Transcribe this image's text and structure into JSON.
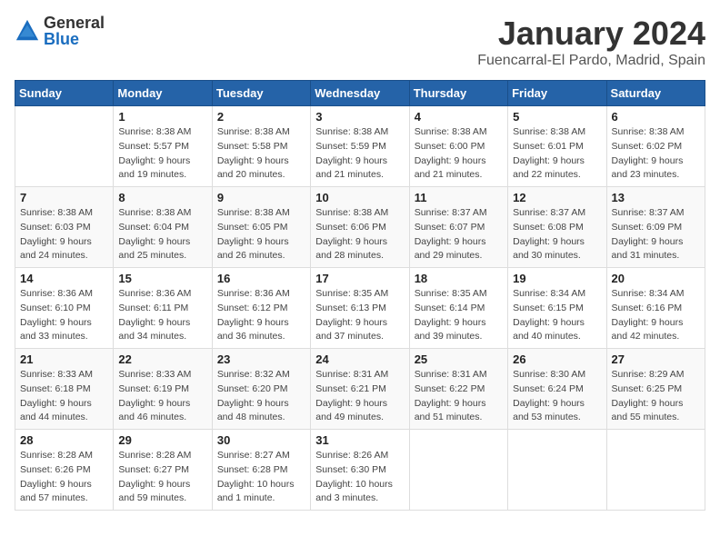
{
  "logo": {
    "general": "General",
    "blue": "Blue"
  },
  "title": "January 2024",
  "subtitle": "Fuencarral-El Pardo, Madrid, Spain",
  "days_header": [
    "Sunday",
    "Monday",
    "Tuesday",
    "Wednesday",
    "Thursday",
    "Friday",
    "Saturday"
  ],
  "weeks": [
    [
      {
        "day": "",
        "info": ""
      },
      {
        "day": "1",
        "info": "Sunrise: 8:38 AM\nSunset: 5:57 PM\nDaylight: 9 hours\nand 19 minutes."
      },
      {
        "day": "2",
        "info": "Sunrise: 8:38 AM\nSunset: 5:58 PM\nDaylight: 9 hours\nand 20 minutes."
      },
      {
        "day": "3",
        "info": "Sunrise: 8:38 AM\nSunset: 5:59 PM\nDaylight: 9 hours\nand 21 minutes."
      },
      {
        "day": "4",
        "info": "Sunrise: 8:38 AM\nSunset: 6:00 PM\nDaylight: 9 hours\nand 21 minutes."
      },
      {
        "day": "5",
        "info": "Sunrise: 8:38 AM\nSunset: 6:01 PM\nDaylight: 9 hours\nand 22 minutes."
      },
      {
        "day": "6",
        "info": "Sunrise: 8:38 AM\nSunset: 6:02 PM\nDaylight: 9 hours\nand 23 minutes."
      }
    ],
    [
      {
        "day": "7",
        "info": "Sunrise: 8:38 AM\nSunset: 6:03 PM\nDaylight: 9 hours\nand 24 minutes."
      },
      {
        "day": "8",
        "info": "Sunrise: 8:38 AM\nSunset: 6:04 PM\nDaylight: 9 hours\nand 25 minutes."
      },
      {
        "day": "9",
        "info": "Sunrise: 8:38 AM\nSunset: 6:05 PM\nDaylight: 9 hours\nand 26 minutes."
      },
      {
        "day": "10",
        "info": "Sunrise: 8:38 AM\nSunset: 6:06 PM\nDaylight: 9 hours\nand 28 minutes."
      },
      {
        "day": "11",
        "info": "Sunrise: 8:37 AM\nSunset: 6:07 PM\nDaylight: 9 hours\nand 29 minutes."
      },
      {
        "day": "12",
        "info": "Sunrise: 8:37 AM\nSunset: 6:08 PM\nDaylight: 9 hours\nand 30 minutes."
      },
      {
        "day": "13",
        "info": "Sunrise: 8:37 AM\nSunset: 6:09 PM\nDaylight: 9 hours\nand 31 minutes."
      }
    ],
    [
      {
        "day": "14",
        "info": "Sunrise: 8:36 AM\nSunset: 6:10 PM\nDaylight: 9 hours\nand 33 minutes."
      },
      {
        "day": "15",
        "info": "Sunrise: 8:36 AM\nSunset: 6:11 PM\nDaylight: 9 hours\nand 34 minutes."
      },
      {
        "day": "16",
        "info": "Sunrise: 8:36 AM\nSunset: 6:12 PM\nDaylight: 9 hours\nand 36 minutes."
      },
      {
        "day": "17",
        "info": "Sunrise: 8:35 AM\nSunset: 6:13 PM\nDaylight: 9 hours\nand 37 minutes."
      },
      {
        "day": "18",
        "info": "Sunrise: 8:35 AM\nSunset: 6:14 PM\nDaylight: 9 hours\nand 39 minutes."
      },
      {
        "day": "19",
        "info": "Sunrise: 8:34 AM\nSunset: 6:15 PM\nDaylight: 9 hours\nand 40 minutes."
      },
      {
        "day": "20",
        "info": "Sunrise: 8:34 AM\nSunset: 6:16 PM\nDaylight: 9 hours\nand 42 minutes."
      }
    ],
    [
      {
        "day": "21",
        "info": "Sunrise: 8:33 AM\nSunset: 6:18 PM\nDaylight: 9 hours\nand 44 minutes."
      },
      {
        "day": "22",
        "info": "Sunrise: 8:33 AM\nSunset: 6:19 PM\nDaylight: 9 hours\nand 46 minutes."
      },
      {
        "day": "23",
        "info": "Sunrise: 8:32 AM\nSunset: 6:20 PM\nDaylight: 9 hours\nand 48 minutes."
      },
      {
        "day": "24",
        "info": "Sunrise: 8:31 AM\nSunset: 6:21 PM\nDaylight: 9 hours\nand 49 minutes."
      },
      {
        "day": "25",
        "info": "Sunrise: 8:31 AM\nSunset: 6:22 PM\nDaylight: 9 hours\nand 51 minutes."
      },
      {
        "day": "26",
        "info": "Sunrise: 8:30 AM\nSunset: 6:24 PM\nDaylight: 9 hours\nand 53 minutes."
      },
      {
        "day": "27",
        "info": "Sunrise: 8:29 AM\nSunset: 6:25 PM\nDaylight: 9 hours\nand 55 minutes."
      }
    ],
    [
      {
        "day": "28",
        "info": "Sunrise: 8:28 AM\nSunset: 6:26 PM\nDaylight: 9 hours\nand 57 minutes."
      },
      {
        "day": "29",
        "info": "Sunrise: 8:28 AM\nSunset: 6:27 PM\nDaylight: 9 hours\nand 59 minutes."
      },
      {
        "day": "30",
        "info": "Sunrise: 8:27 AM\nSunset: 6:28 PM\nDaylight: 10 hours\nand 1 minute."
      },
      {
        "day": "31",
        "info": "Sunrise: 8:26 AM\nSunset: 6:30 PM\nDaylight: 10 hours\nand 3 minutes."
      },
      {
        "day": "",
        "info": ""
      },
      {
        "day": "",
        "info": ""
      },
      {
        "day": "",
        "info": ""
      }
    ]
  ]
}
